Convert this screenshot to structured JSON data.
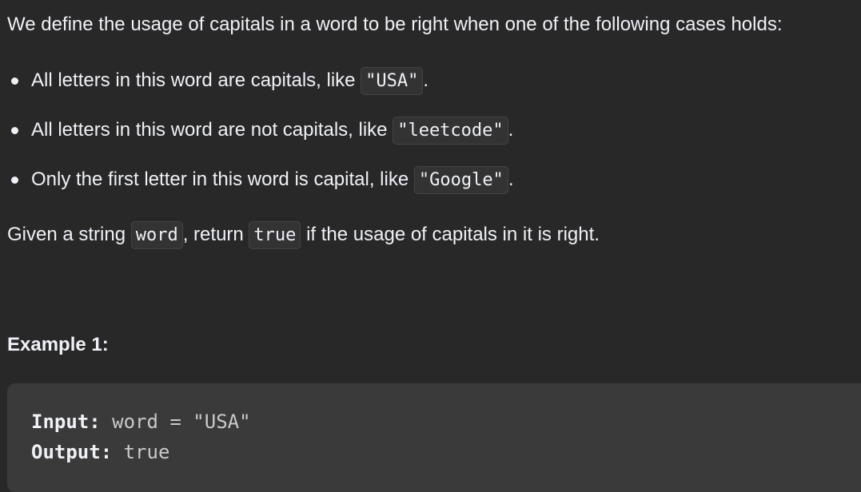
{
  "intro": "We define the usage of capitals in a word to be right when one of the following cases holds:",
  "cases": [
    {
      "text": "All letters in this word are capitals, like ",
      "code": "\"USA\"",
      "end": "."
    },
    {
      "text": "All letters in this word are not capitals, like ",
      "code": "\"leetcode\"",
      "end": "."
    },
    {
      "text": "Only the first letter in this word is capital, like ",
      "code": "\"Google\"",
      "end": "."
    }
  ],
  "given": {
    "part1": "Given a string ",
    "code1": "word",
    "part2": ", return ",
    "code2": "true",
    "part3": " if the usage of capitals in it is right."
  },
  "example": {
    "title": "Example 1:",
    "input_label": "Input:",
    "input_value": "word = \"USA\"",
    "output_label": "Output:",
    "output_value": "true"
  },
  "colors": {
    "background": "#282828",
    "text": "#eff1f6",
    "code_background": "#333333",
    "example_background": "#3a3a3a"
  }
}
